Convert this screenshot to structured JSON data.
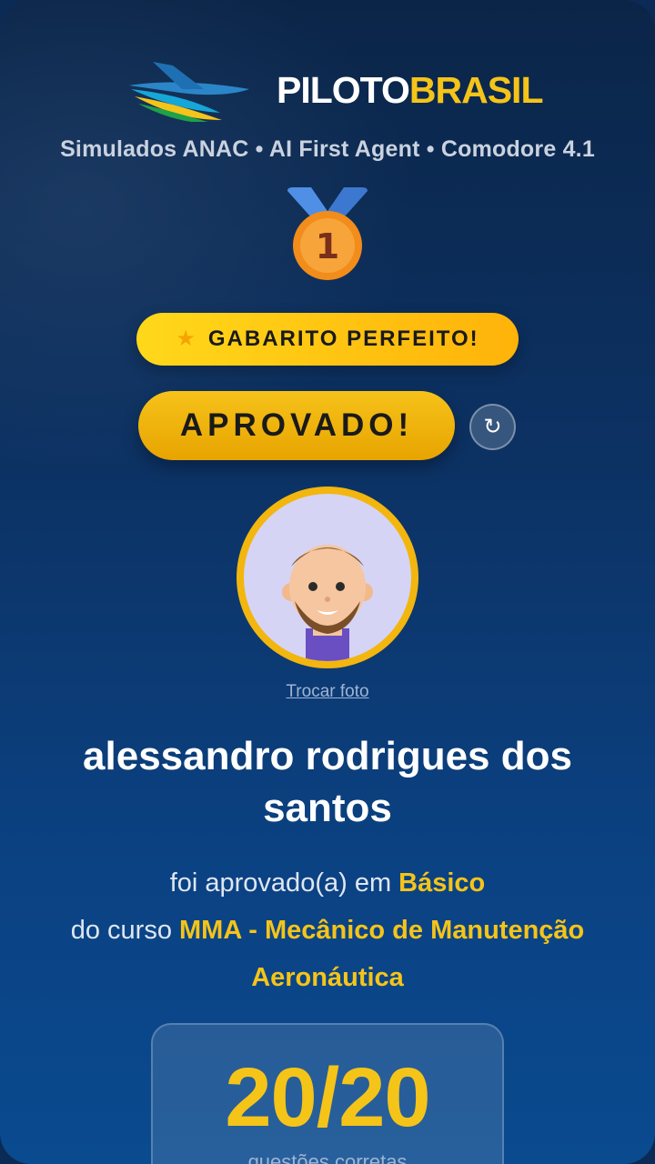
{
  "brand": {
    "name_white": "PILOTO",
    "name_yellow": "BRASIL",
    "logo_icon": "plane-logo-icon"
  },
  "subtitle": "Simulados ANAC • AI First Agent • Comodore 4.1",
  "medal": {
    "icon": "first-place-medal-icon",
    "rank": "1"
  },
  "badge_perfect": {
    "icon": "star-icon",
    "label": "GABARITO PERFEITO!"
  },
  "status": {
    "label": "APROVADO!",
    "refresh_icon": "↻"
  },
  "avatar": {
    "icon": "user-avatar-icon",
    "change_label": "Trocar foto"
  },
  "student": {
    "name": "alessandro rodrigues dos santos"
  },
  "result": {
    "line1_prefix": "foi aprovado(a) em",
    "level": "Básico",
    "line2_prefix": "do curso",
    "course": "MMA - Mecânico de Manutenção Aeronáutica"
  },
  "score": {
    "value": "20/20",
    "caption": "questões corretas"
  },
  "colors": {
    "accent": "#f5c419",
    "background": "#0c3264",
    "text": "#ffffff"
  }
}
